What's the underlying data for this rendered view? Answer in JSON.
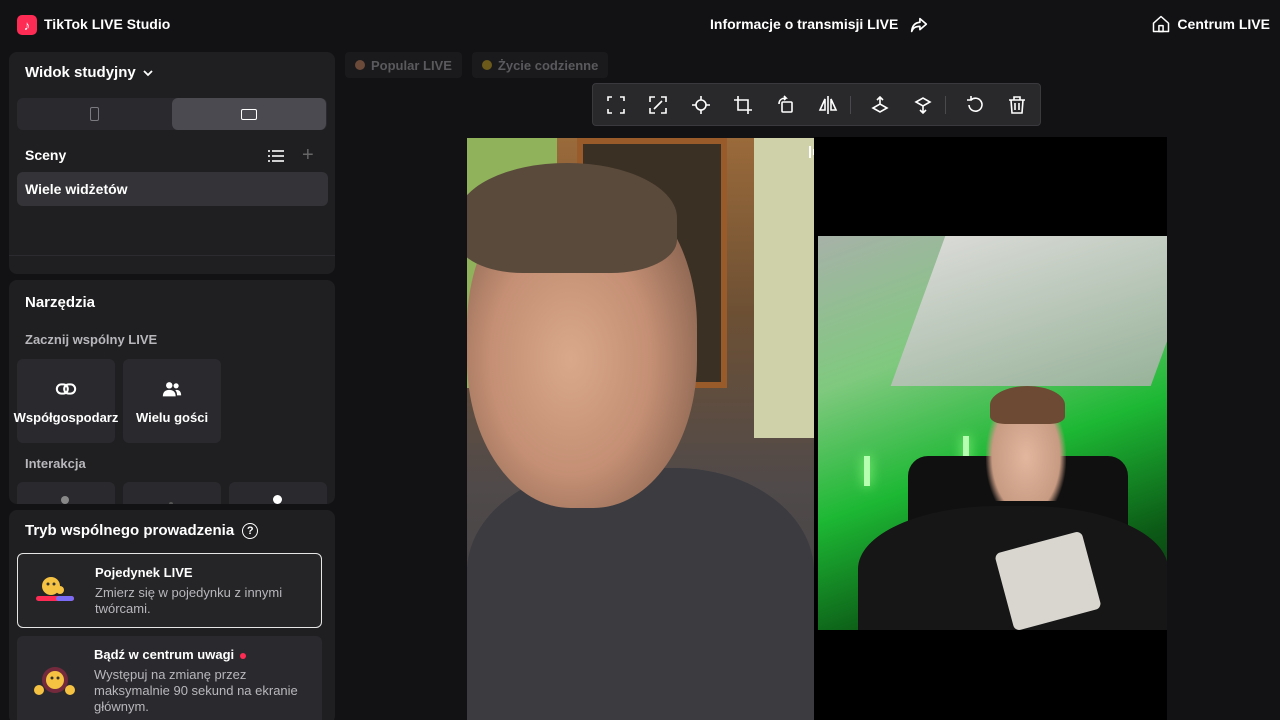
{
  "app": {
    "title": "TikTok LIVE Studio",
    "logo_glyph": "♪"
  },
  "header": {
    "center_title": "Informacje o transmisji LIVE",
    "hub_label": "Centrum LIVE"
  },
  "sidebar": {
    "studio_view_label": "Widok studyjny",
    "scenes_title": "Sceny",
    "scene_items": [
      "Wiele widżetów"
    ],
    "tools_title": "Narzędzia",
    "start_joint_live_label": "Zacznij wspólny LIVE",
    "tool_cards": [
      {
        "label": "Współgospodarz",
        "icon": "link-icon"
      },
      {
        "label": "Wielu gości",
        "icon": "users-icon"
      }
    ],
    "interaction_label": "Interakcja",
    "cohost_title": "Tryb wspólnego prowadzenia",
    "help_glyph": "?",
    "modes": [
      {
        "name": "Pojedynek LIVE",
        "desc": "Zmierz się w pojedynku z innymi twórcami.",
        "selected": true
      },
      {
        "name": "Bądź w centrum uwagi",
        "desc": "Występuj na zmianę przez maksymalnie 90 sekund na ekranie głównym.",
        "selected": false
      }
    ]
  },
  "stage": {
    "tags": [
      {
        "label": "Popular LIVE",
        "color": "#6b4a3a"
      },
      {
        "label": "Życie codzienne",
        "color": "#6b5a1a"
      }
    ],
    "toolbar_icons": [
      "fit-icon",
      "expand-icon",
      "center-icon",
      "crop-icon",
      "rotate-icon",
      "flip-horizontal-icon",
      "move-up-layer-icon",
      "move-down-layer-icon",
      "undo-icon",
      "delete-icon"
    ]
  },
  "colors": {
    "accent": "#fe2c55",
    "background": "#121214",
    "panel": "#1f1f22"
  }
}
